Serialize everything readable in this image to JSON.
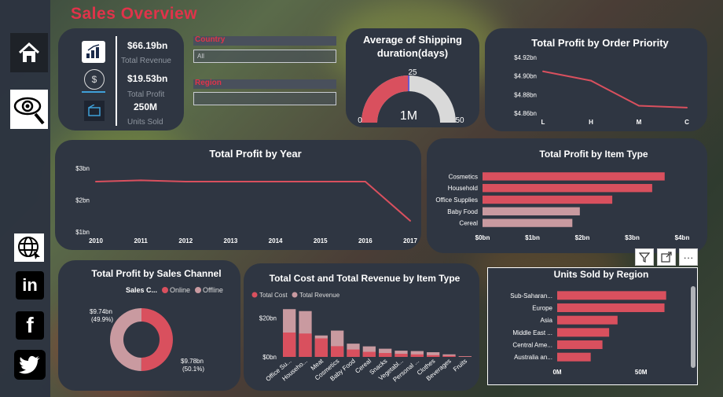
{
  "title": "Sales  Overview",
  "kpis": [
    {
      "value": "$66.19bn",
      "label": "Total Revenue"
    },
    {
      "value": "$19.53bn",
      "label": "Total Profit"
    },
    {
      "value": "250M",
      "label": "Units Sold"
    }
  ],
  "filters": {
    "country_label": "Country",
    "country_value": "All",
    "region_label": "Region",
    "region_value": ""
  },
  "gauge": {
    "title_line1": "Average of Shipping",
    "title_line2": "duration(days)",
    "value_label": "1M",
    "min": "0",
    "max": "50",
    "target": "25",
    "fill_fraction": 0.5
  },
  "toolbar": {
    "filter_icon": "filter-icon",
    "focus_icon": "focus-mode-icon",
    "more_label": "···"
  },
  "charts": {
    "priority": {
      "title": "Total Profit by Order Priority",
      "chart_data": {
        "type": "line",
        "categories": [
          "L",
          "H",
          "M",
          "C"
        ],
        "values": [
          4.905,
          4.895,
          4.868,
          4.866
        ],
        "yticks": [
          "$4.92bn",
          "$4.90bn",
          "$4.88bn",
          "$4.86bn"
        ],
        "ylim": [
          4.86,
          4.92
        ]
      }
    },
    "year": {
      "title": "Total Profit by Year",
      "chart_data": {
        "type": "line",
        "categories": [
          "2010",
          "2011",
          "2012",
          "2013",
          "2014",
          "2015",
          "2016",
          "2017"
        ],
        "values": [
          2.58,
          2.62,
          2.58,
          2.58,
          2.58,
          2.58,
          2.58,
          1.35
        ],
        "yticks": [
          "$3bn",
          "$2bn",
          "$1bn"
        ],
        "ylim": [
          1,
          3
        ]
      }
    },
    "item_type": {
      "title": "Total Profit by Item Type",
      "chart_data": {
        "type": "bar",
        "categories": [
          "Cosmetics",
          "Household",
          "Office Supplies",
          "Baby Food",
          "Cereal"
        ],
        "values": [
          3.65,
          3.4,
          2.6,
          1.95,
          1.8
        ],
        "xticks": [
          "$0bn",
          "$1bn",
          "$2bn",
          "$3bn",
          "$4bn"
        ],
        "xlim": [
          0,
          4
        ]
      }
    },
    "channel": {
      "title": "Total Profit by Sales Channel",
      "legend_title": "Sales C...",
      "legend": [
        "Online",
        "Offline"
      ],
      "chart_data": {
        "type": "pie",
        "categories": [
          "Online",
          "Offline"
        ],
        "values": [
          9.78,
          9.74
        ],
        "labels": [
          {
            "value": "$9.78bn",
            "pct": "(50.1%)"
          },
          {
            "value": "$9.74bn",
            "pct": "(49.9%)"
          }
        ],
        "colors": [
          "#d9505e",
          "#c99aa0"
        ]
      }
    },
    "cost_revenue": {
      "title": "Total Cost and Total Revenue by Item Type",
      "legend": [
        "Total Cost",
        "Total Revenue"
      ],
      "chart_data": {
        "type": "bar",
        "categories": [
          "Office Su...",
          "Househo...",
          "Meat",
          "Cosmetics",
          "Baby Food",
          "Cereal",
          "Snacks",
          "Vegetabl...",
          "Personal ...",
          "Clothes",
          "Beverages",
          "Fruits"
        ],
        "series": [
          {
            "name": "Total Cost",
            "values": [
              12.5,
              12.0,
              9.5,
              5.5,
              3.8,
              2.6,
              2.0,
              1.6,
              1.3,
              0.9,
              0.6,
              0.2
            ]
          },
          {
            "name": "Total Revenue",
            "values": [
              24.5,
              23.5,
              11.0,
              13.5,
              6.8,
              5.4,
              4.2,
              3.2,
              3.0,
              2.4,
              1.3,
              0.4
            ]
          }
        ],
        "yticks": [
          "$20bn",
          "$0bn"
        ],
        "ylim": [
          0,
          25
        ]
      }
    },
    "region": {
      "title": "Units Sold by Region",
      "chart_data": {
        "type": "bar",
        "categories": [
          "Sub-Saharan...",
          "Europe",
          "Asia",
          "Middle East ...",
          "Central Ame...",
          "Australia an..."
        ],
        "values": [
          65,
          64,
          36,
          31,
          27,
          20
        ],
        "xticks": [
          "0M",
          "50M"
        ],
        "xlim": [
          0,
          75
        ]
      }
    }
  },
  "colors": {
    "accent": "#e0334a",
    "bar": "#d9505e",
    "bar_light": "#c99aa0",
    "card": "#2f3642"
  }
}
